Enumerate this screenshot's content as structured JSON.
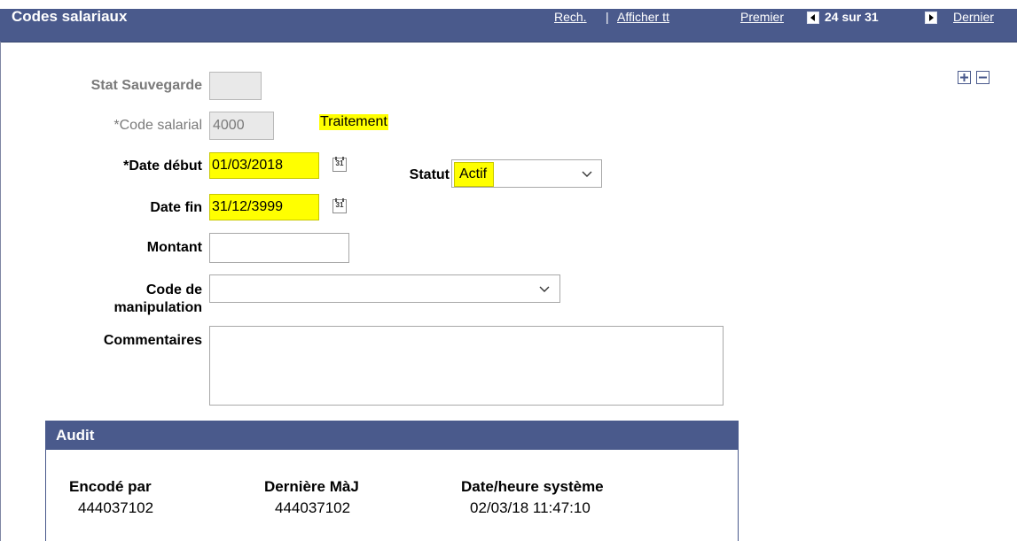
{
  "header": {
    "title": "Codes salariaux",
    "nav": {
      "search": "Rech.",
      "separator": "|",
      "show_all": "Afficher tt",
      "first": "Premier",
      "count": "24 sur 31",
      "last": "Dernier"
    }
  },
  "form": {
    "save_status": {
      "label": "Stat Sauvegarde",
      "value": ""
    },
    "pay_code": {
      "label": "*Code salarial",
      "value": "4000",
      "description": "Traitement"
    },
    "start_date": {
      "label": "*Date début",
      "value": "01/03/2018",
      "calendar_glyph": "31"
    },
    "status": {
      "label": "Statut",
      "value": "Actif"
    },
    "end_date": {
      "label": "Date fin",
      "value": "31/12/3999",
      "calendar_glyph": "31"
    },
    "amount": {
      "label": "Montant",
      "value": ""
    },
    "handling_code": {
      "label": "Code de manipulation",
      "value": ""
    },
    "comments": {
      "label": "Commentaires",
      "value": ""
    }
  },
  "audit": {
    "title": "Audit",
    "columns": [
      {
        "label": "Encodé par",
        "value": "444037102"
      },
      {
        "label": "Dernière MàJ",
        "value": "444037102"
      },
      {
        "label": "Date/heure système",
        "value": "02/03/18 11:47:10"
      }
    ]
  },
  "icons": {
    "add": "plus-icon",
    "remove": "minus-icon",
    "prev": "prev-arrow-icon",
    "next": "next-arrow-icon",
    "calendar": "calendar-icon"
  },
  "colors": {
    "header_bg": "#4a5a8c",
    "highlight": "#ffff00"
  }
}
